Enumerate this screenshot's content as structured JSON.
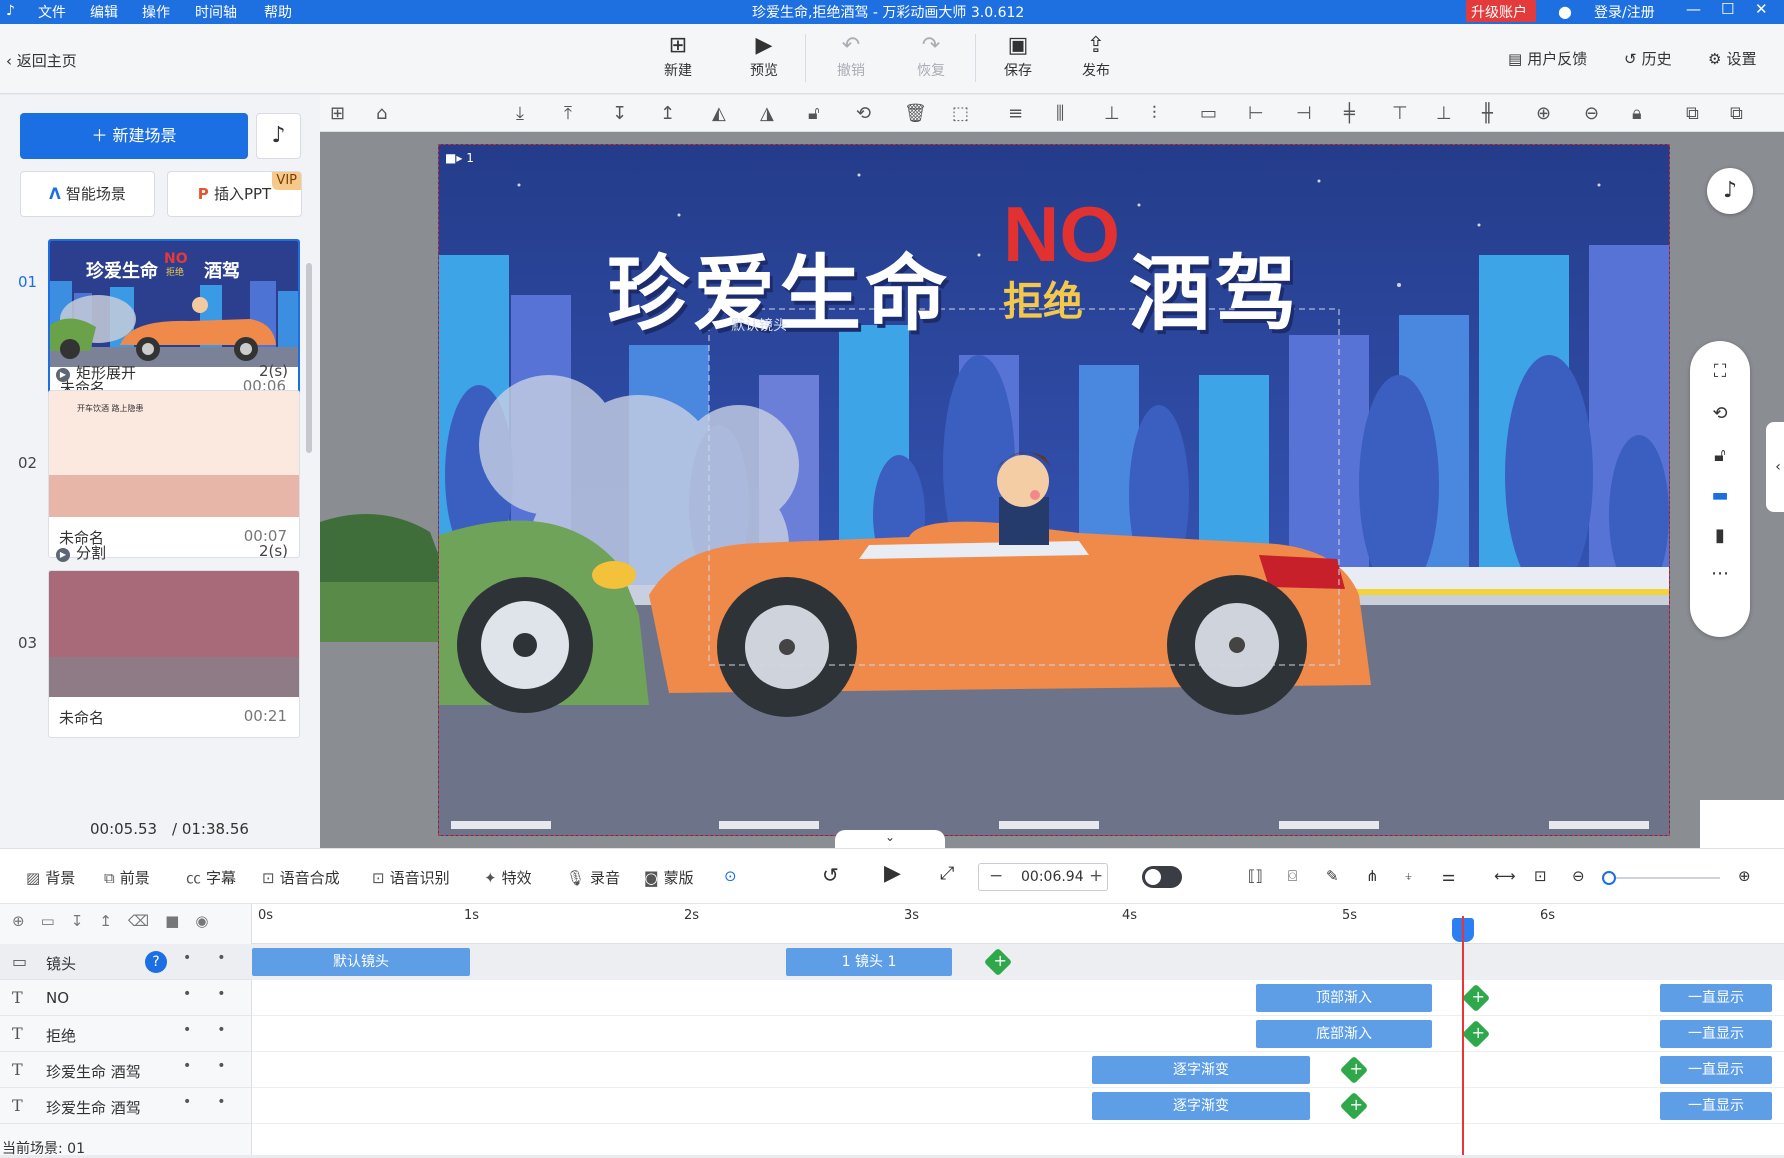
{
  "titlebar": {
    "menu": [
      "文件",
      "编辑",
      "操作",
      "时间轴",
      "帮助"
    ],
    "title": "珍爱生命,拒绝酒驾 - 万彩动画大师 3.0.612",
    "upgrade": "升级账户",
    "login": "登录/注册"
  },
  "toolbar": {
    "back": "返回主页",
    "new": "新建",
    "preview": "预览",
    "undo": "撤销",
    "redo": "恢复",
    "save": "保存",
    "publish": "发布",
    "feedback": "用户反馈",
    "history": "历史",
    "settings": "设置"
  },
  "leftpanel": {
    "new_scene": "新建场景",
    "smart_scene": "智能场景",
    "insert_ppt": "插入PPT",
    "vip": "VIP",
    "scenes": [
      {
        "num": "01",
        "name": "未命名",
        "duration": "00:06"
      },
      {
        "num": "02",
        "name": "未命名",
        "duration": "00:07"
      },
      {
        "num": "03",
        "name": "未命名",
        "duration": "00:21"
      }
    ],
    "transitions": [
      {
        "name": "矩形展开",
        "length": "2(s)"
      },
      {
        "name": "分割",
        "length": "2(s)"
      }
    ],
    "current_time": "00:05.53",
    "total_time": "/ 01:38.56",
    "thumb1_title": "珍爱生命",
    "thumb1_no": "NO",
    "thumb1_reject": "拒绝",
    "thumb1_drunk": "酒驾",
    "thumb2_title": "开车饮酒 路上隐患"
  },
  "scene": {
    "camera_label": "1",
    "title_left": "珍爱生命",
    "title_no": "NO",
    "title_reject": "拒绝",
    "title_right": "酒驾",
    "default_camera": "默认镜头"
  },
  "timeline_controls": {
    "background": "背景",
    "foreground": "前景",
    "subtitle": "字幕",
    "tts": "语音合成",
    "asr": "语音识别",
    "effects": "特效",
    "record": "录音",
    "mask": "蒙版",
    "time_value": "00:06.94"
  },
  "timeline": {
    "ruler": [
      "0s",
      "1s",
      "2s",
      "3s",
      "4s",
      "5s",
      "6s"
    ],
    "rows": [
      {
        "label": "镜头",
        "type": "camera"
      },
      {
        "label": "NO",
        "type": "text"
      },
      {
        "label": "拒绝",
        "type": "text"
      },
      {
        "label": "珍爱生命  酒驾",
        "type": "text"
      },
      {
        "label": "珍爱生命  酒驾",
        "type": "text"
      }
    ],
    "segments": {
      "default_camera": "默认镜头",
      "camera1": "1 镜头 1",
      "top_in": "顶部渐入",
      "bottom_in": "底部渐入",
      "word_fade_1": "逐字渐变",
      "word_fade_2": "逐字渐变",
      "always_1": "一直显示",
      "always_2": "一直显示",
      "always_3": "一直显示",
      "always_4": "一直显示"
    },
    "status": "当前场景: 01"
  },
  "colors": {
    "accent": "#1c6fe2",
    "titlebar": "#1e6fe0",
    "upgrade": "#e33b3b",
    "segment": "#5d9ee6",
    "keyframe": "#2ea84a",
    "playhead": "#ee3333"
  }
}
